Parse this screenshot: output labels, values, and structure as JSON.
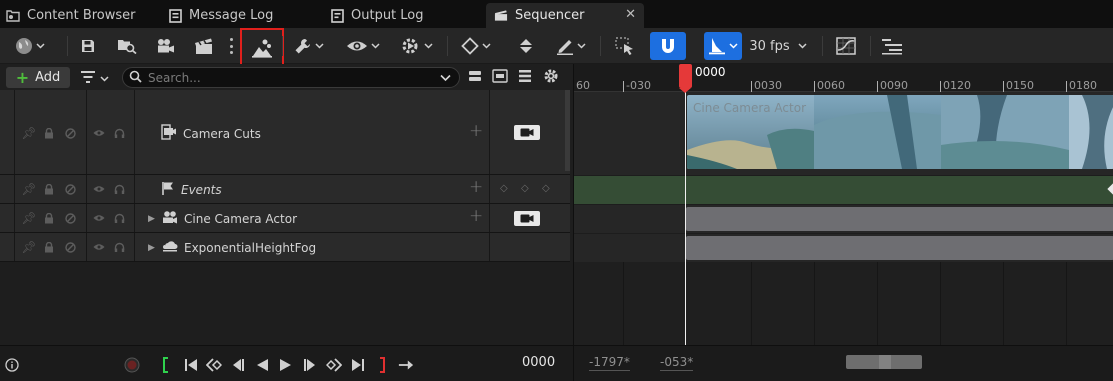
{
  "tabs": [
    {
      "label": "Content Browser",
      "icon": "folder-icon",
      "active": false
    },
    {
      "label": "Message Log",
      "icon": "log-icon",
      "active": false
    },
    {
      "label": "Output Log",
      "icon": "output-log-icon",
      "active": false
    },
    {
      "label": "Sequencer",
      "icon": "clapperboard-icon",
      "active": true
    }
  ],
  "toolbar": {
    "fps_label": "30 fps",
    "highlighted_button": "camera-cut-track-button",
    "accent_color": "#1d6fe0",
    "highlight_color": "#e0201c"
  },
  "filterbar": {
    "add_label": "Add",
    "search_placeholder": "Search..."
  },
  "tracks": [
    {
      "name": "Camera Cuts",
      "icon": "camera-cut-icon",
      "expandable": false,
      "italic": false,
      "has_camera_button": true
    },
    {
      "name": "Events",
      "icon": "flag-icon",
      "expandable": false,
      "italic": true,
      "has_camera_button": false
    },
    {
      "name": "Cine Camera Actor",
      "icon": "actors-icon",
      "expandable": true,
      "italic": false,
      "has_camera_button": true
    },
    {
      "name": "ExponentialHeightFog",
      "icon": "fog-icon",
      "expandable": true,
      "italic": false,
      "has_camera_button": false
    }
  ],
  "timeline": {
    "current_frame": "0000",
    "ruler_labels": [
      "60",
      "-030",
      "0030",
      "0060",
      "0090",
      "0120",
      "0150",
      "0180"
    ],
    "clip_label": "Cine Camera Actor",
    "playhead_color": "#e53939"
  },
  "transport": {
    "current_frame": "0000"
  },
  "view_range": {
    "start": "-1797*",
    "end": "-053*"
  }
}
